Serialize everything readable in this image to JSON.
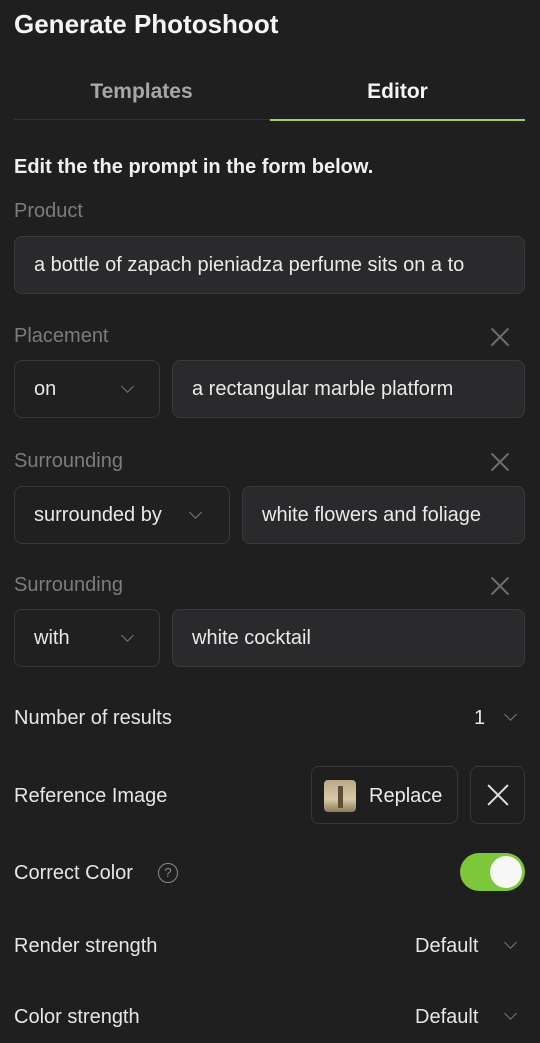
{
  "app": {
    "title": "Generate Photoshoot"
  },
  "tabs": [
    {
      "label": "Templates",
      "active": false
    },
    {
      "label": "Editor",
      "active": true
    }
  ],
  "editor": {
    "instruction": "Edit the the prompt in the form below.",
    "product": {
      "label": "Product",
      "value": "a bottle of zapach pieniadza perfume sits on a to"
    },
    "placement": {
      "label": "Placement",
      "preposition": "on",
      "value": "a rectangular marble platform"
    },
    "surrounding1": {
      "label": "Surrounding",
      "preposition": "surrounded by",
      "value": "white flowers and foliage"
    },
    "surrounding2": {
      "label": "Surrounding",
      "preposition": "with",
      "value": "white cocktail"
    }
  },
  "settings": {
    "num_results": {
      "label": "Number of results",
      "value": "1"
    },
    "reference_image": {
      "label": "Reference Image",
      "replace_label": "Replace"
    },
    "correct_color": {
      "label": "Correct Color",
      "help_glyph": "?",
      "enabled": true
    },
    "render_strength": {
      "label": "Render strength",
      "value": "Default"
    },
    "color_strength": {
      "label": "Color strength",
      "value": "Default"
    }
  },
  "colors": {
    "accent": "#7dc73a",
    "background": "#1f1f20",
    "field": "#2a2a2c"
  }
}
